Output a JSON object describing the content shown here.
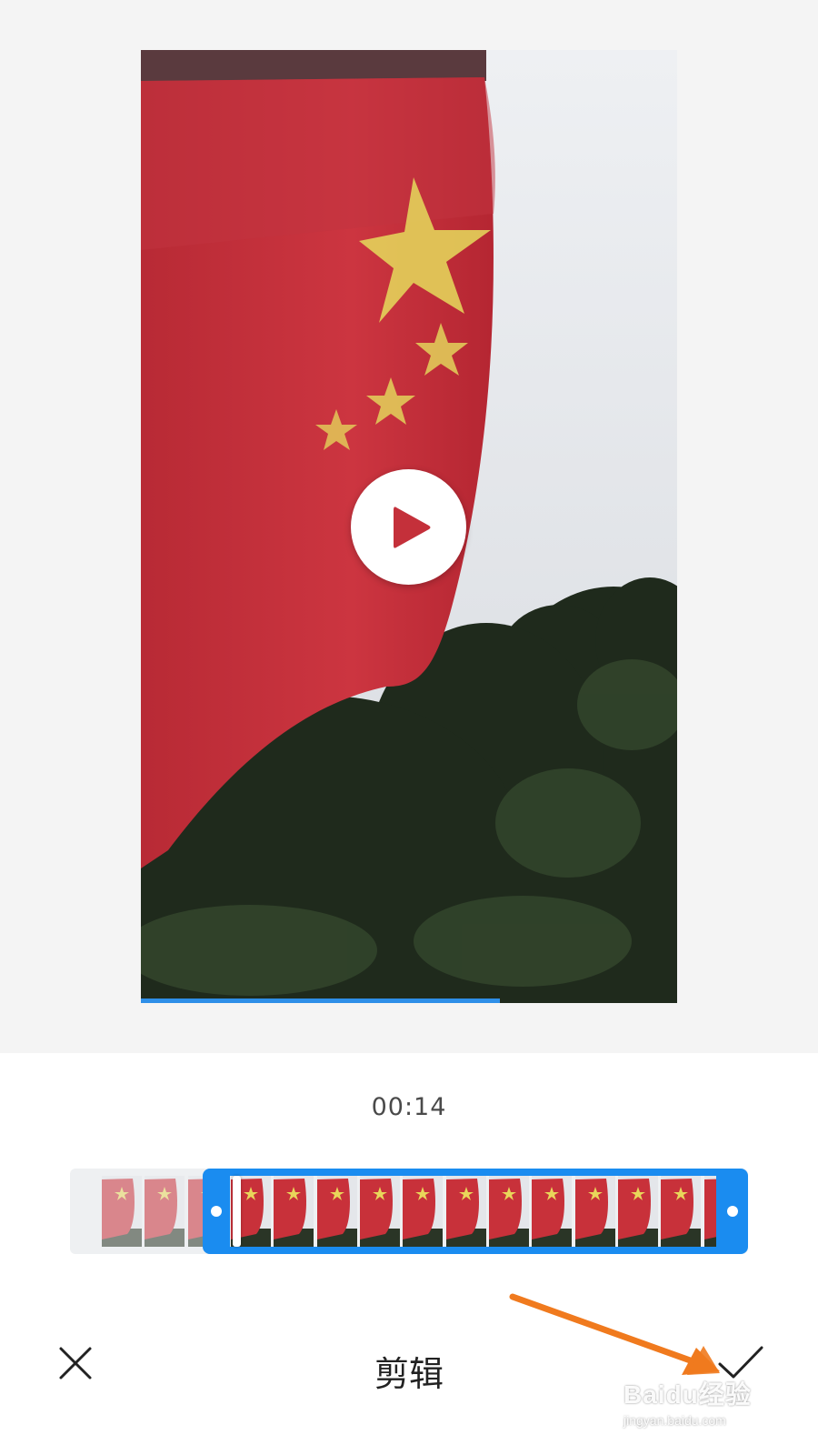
{
  "video": {
    "progress_fraction": 0.67,
    "play_icon": "play-icon"
  },
  "editor": {
    "current_time": "00:14",
    "title": "剪辑",
    "cancel_icon": "close-icon",
    "confirm_icon": "checkmark-icon"
  },
  "timeline": {
    "total_frames": 15,
    "selection_start_fraction": 0.2,
    "selection_end_fraction": 1.0
  },
  "colors": {
    "accent": "#1a8cf0",
    "progress": "#2e8fe8",
    "annotation_arrow": "#f07a1e",
    "flag_red": "#c8313a",
    "flag_star": "#e9d65a"
  },
  "watermark": {
    "brand": "Baidu经验",
    "url": "jingyan.baidu.com"
  }
}
